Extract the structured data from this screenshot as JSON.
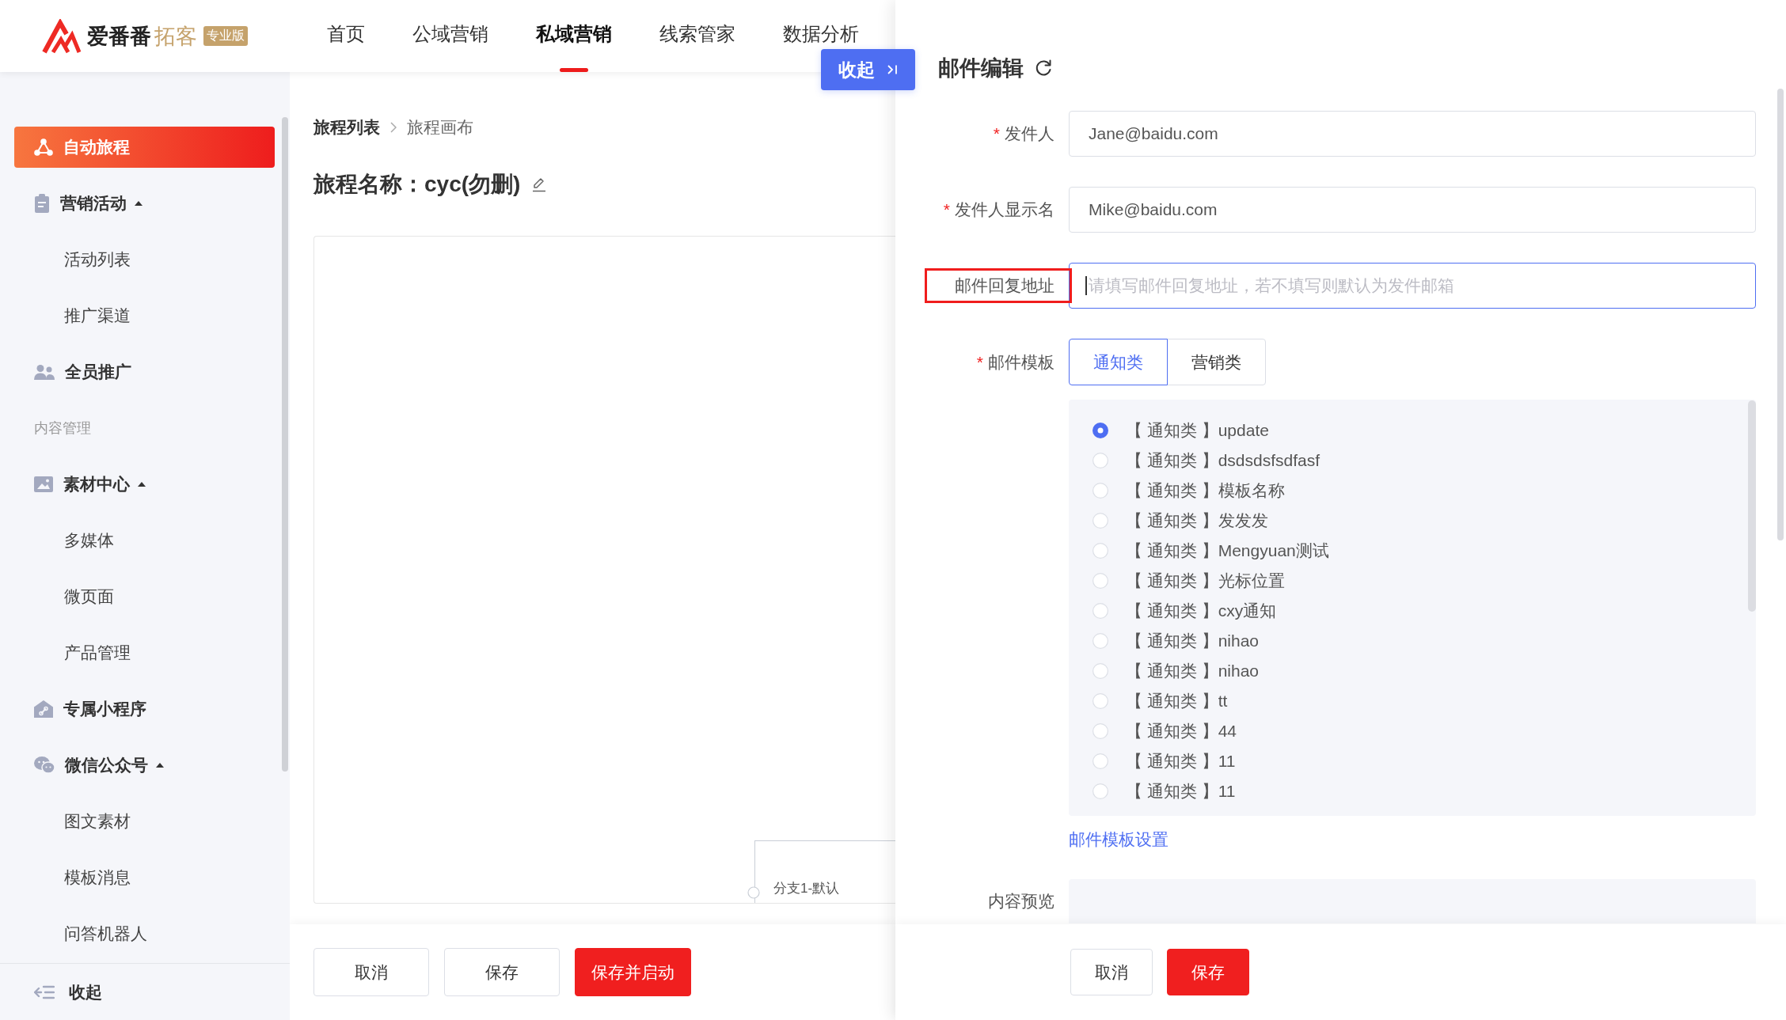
{
  "header": {
    "logo": {
      "name": "爱番番",
      "product": "拓客",
      "badge": "专业版"
    },
    "nav": [
      {
        "label": "首页",
        "selected": false
      },
      {
        "label": "公域营销",
        "selected": false
      },
      {
        "label": "私域营销",
        "selected": true
      },
      {
        "label": "线索管家",
        "selected": false
      },
      {
        "label": "数据分析",
        "selected": false
      }
    ]
  },
  "collapse_button": {
    "label": "收起"
  },
  "sidebar": {
    "items": [
      {
        "kind": "item",
        "label": "自动旅程",
        "selected": true
      },
      {
        "kind": "group",
        "label": "营销活动",
        "selected": false,
        "expanded": true,
        "children": [
          {
            "label": "活动列表",
            "selected": false
          },
          {
            "label": "推广渠道",
            "selected": false
          }
        ]
      },
      {
        "kind": "item",
        "label": "全员推广",
        "selected": false
      },
      {
        "kind": "section",
        "label": "内容管理"
      },
      {
        "kind": "group",
        "label": "素材中心",
        "selected": false,
        "expanded": true,
        "children": [
          {
            "label": "多媒体",
            "selected": false
          },
          {
            "label": "微页面",
            "selected": false
          },
          {
            "label": "产品管理",
            "selected": false
          }
        ]
      },
      {
        "kind": "item",
        "label": "专属小程序",
        "selected": false
      },
      {
        "kind": "group",
        "label": "微信公众号",
        "selected": false,
        "expanded": true,
        "children": [
          {
            "label": "图文素材",
            "selected": false
          },
          {
            "label": "模板消息",
            "selected": false
          },
          {
            "label": "问答机器人",
            "selected": false
          }
        ]
      }
    ],
    "footer": {
      "label": "收起"
    }
  },
  "breadcrumb": [
    {
      "label": "旅程列表",
      "current": false
    },
    {
      "label": "旅程画布",
      "current": true
    }
  ],
  "journey": {
    "title": "旅程名称：cyc(勿删)"
  },
  "canvas": {
    "nodes": [
      {
        "label": "分支1-默认"
      }
    ]
  },
  "footer_buttons": [
    {
      "label": "取消",
      "kind": "default"
    },
    {
      "label": "保存",
      "kind": "default"
    },
    {
      "label": "保存并启动",
      "kind": "primary"
    }
  ],
  "drawer": {
    "title": "邮件编辑",
    "fields": [
      {
        "required_mark": "*",
        "label": "发件人",
        "value": "Jane@baidu.com",
        "focused": false,
        "highlighted": false
      },
      {
        "required_mark": "*",
        "label": "发件人显示名",
        "value": "Mike@baidu.com",
        "focused": false,
        "highlighted": false
      },
      {
        "label": "邮件回复地址",
        "placeholder": "请填写邮件回复地址，若不填写则默认为发件邮箱",
        "focused": true,
        "highlighted": true
      }
    ],
    "template": {
      "required_mark": "*",
      "label": "邮件模板",
      "tabs": [
        {
          "label": "通知类",
          "selected": true
        },
        {
          "label": "营销类",
          "selected": false
        }
      ],
      "options": [
        {
          "label": "【 通知类 】update",
          "selected": true
        },
        {
          "label": "【 通知类 】dsdsdsfsdfasf",
          "selected": false
        },
        {
          "label": "【 通知类 】模板名称",
          "selected": false
        },
        {
          "label": "【 通知类 】发发发",
          "selected": false
        },
        {
          "label": "【 通知类 】Mengyuan测试",
          "selected": false
        },
        {
          "label": "【 通知类 】光标位置",
          "selected": false
        },
        {
          "label": "【 通知类 】cxy通知",
          "selected": false
        },
        {
          "label": "【 通知类 】nihao",
          "selected": false
        },
        {
          "label": "【 通知类 】nihao",
          "selected": false
        },
        {
          "label": "【 通知类 】tt",
          "selected": false
        },
        {
          "label": "【 通知类 】44",
          "selected": false
        },
        {
          "label": "【 通知类 】11",
          "selected": false
        },
        {
          "label": "【 通知类 】11",
          "selected": false
        }
      ],
      "settings_link": "邮件模板设置"
    },
    "preview": {
      "label": "内容预览"
    },
    "buttons": [
      {
        "label": "取消",
        "kind": "default"
      },
      {
        "label": "保存",
        "kind": "primary"
      }
    ]
  }
}
